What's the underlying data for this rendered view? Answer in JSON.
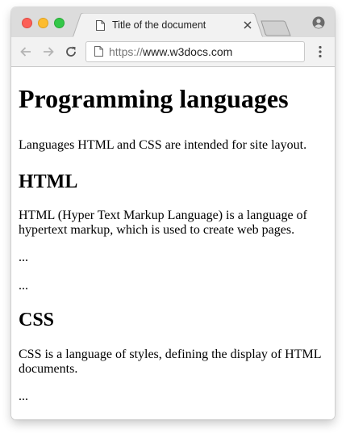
{
  "browser": {
    "tab_title": "Title of the document",
    "url": "https://www.w3docs.com",
    "url_prefix": "https://",
    "url_host": "www.w3docs.com",
    "traffic_lights": {
      "close": "#fc5f57",
      "minimize": "#fdbc2e",
      "maximize": "#33c748"
    }
  },
  "page": {
    "heading": "Programming languages",
    "intro": "Languages HTML and CSS are intended for site layout.",
    "sections": [
      {
        "heading": "HTML",
        "paragraphs": [
          "HTML (Hyper Text Markup Language) is a language of hypertext markup, which is used to create web pages.",
          "...",
          "..."
        ]
      },
      {
        "heading": "CSS",
        "paragraphs": [
          "CSS is a language of styles, defining the display of HTML documents.",
          "..."
        ]
      }
    ]
  }
}
